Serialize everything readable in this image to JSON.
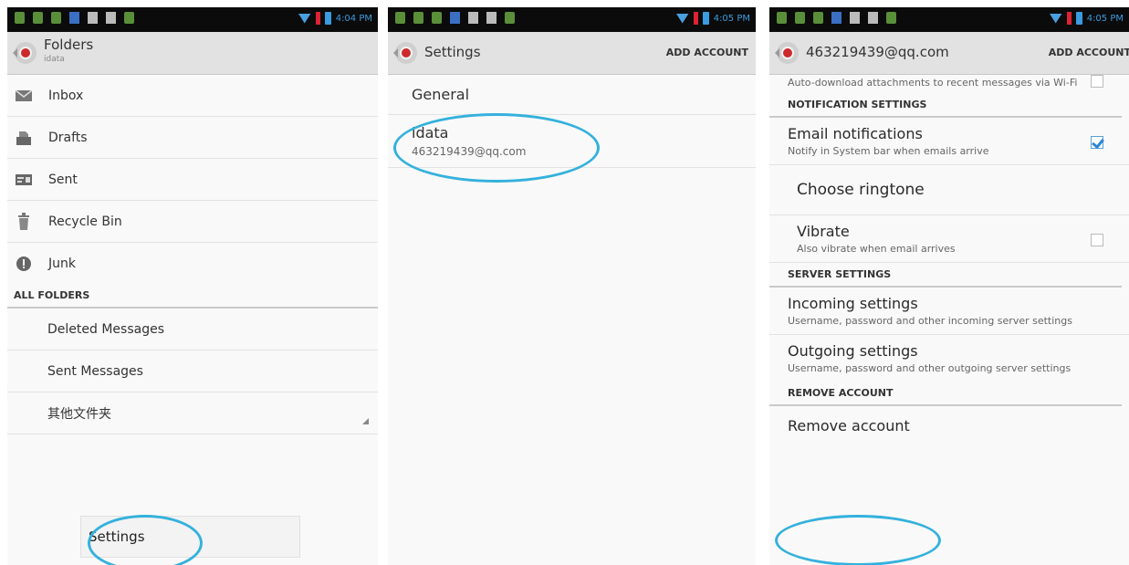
{
  "statusbars": [
    {
      "time": "4:04 PM"
    },
    {
      "time": "4:05 PM"
    },
    {
      "time": "4:05 PM"
    }
  ],
  "folders_screen": {
    "title": "Folders",
    "subtitle": "idata",
    "items": [
      {
        "label": "Inbox",
        "icon": "inbox-icon"
      },
      {
        "label": "Drafts",
        "icon": "drafts-icon"
      },
      {
        "label": "Sent",
        "icon": "sent-icon"
      },
      {
        "label": "Recycle Bin",
        "icon": "recycle-bin-icon"
      },
      {
        "label": "Junk",
        "icon": "junk-icon"
      }
    ],
    "all_folders_header": "ALL FOLDERS",
    "all_folders": [
      "Deleted Messages",
      "Sent Messages",
      "其他文件夹"
    ],
    "menu_item": "Settings"
  },
  "settings_screen": {
    "title": "Settings",
    "action": "ADD ACCOUNT",
    "general": "General",
    "account_name": "idata",
    "account_email": "463219439@qq.com"
  },
  "account_screen": {
    "title": "463219439@qq.com",
    "action": "ADD ACCOUNT",
    "auto_download": "Auto-download attachments to recent messages via Wi-Fi",
    "notification_header": "NOTIFICATION SETTINGS",
    "email_notifications": "Email notifications",
    "email_notifications_sub": "Notify in System bar when emails arrive",
    "choose_ringtone": "Choose ringtone",
    "vibrate": "Vibrate",
    "vibrate_sub": "Also vibrate when email arrives",
    "server_header": "SERVER SETTINGS",
    "incoming": "Incoming settings",
    "incoming_sub": "Username, password and other incoming server settings",
    "outgoing": "Outgoing settings",
    "outgoing_sub": "Username, password and other outgoing server settings",
    "remove_header": "REMOVE ACCOUNT",
    "remove": "Remove account"
  },
  "colors": {
    "highlight": "#34b1dd",
    "accent": "#2f86d6"
  }
}
